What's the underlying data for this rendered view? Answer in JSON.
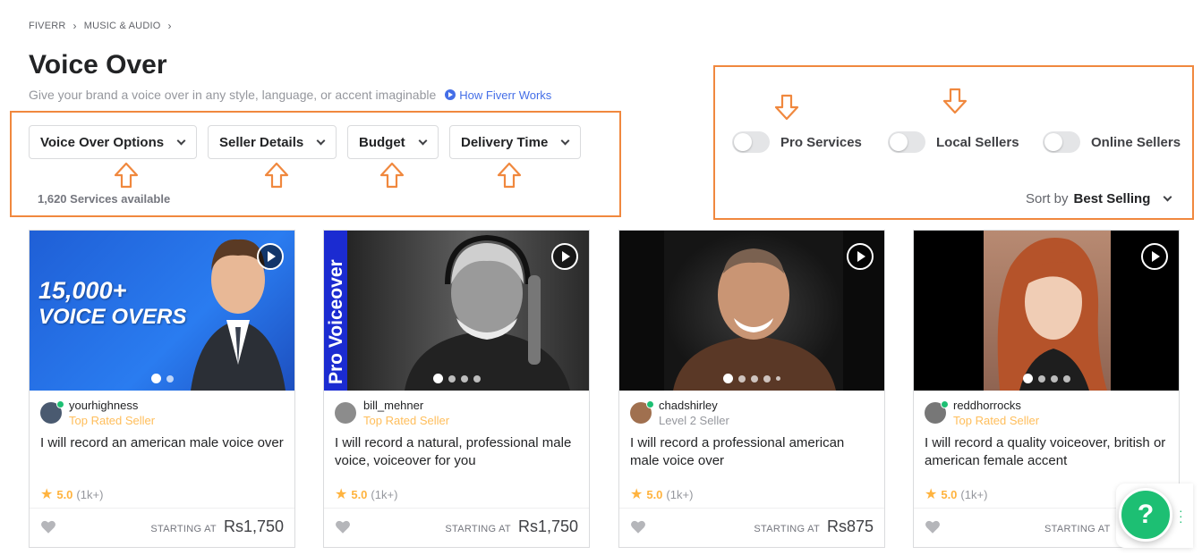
{
  "breadcrumb": {
    "items": [
      "FIVERR",
      "MUSIC & AUDIO"
    ],
    "sep": "›"
  },
  "page": {
    "title": "Voice Over",
    "subtitle": "Give your brand a voice over in any style, language, or accent imaginable",
    "how_link": "How Fiverr Works"
  },
  "filters": {
    "voice_over_options": "Voice Over Options",
    "seller_details": "Seller Details",
    "budget": "Budget",
    "delivery_time": "Delivery Time",
    "services_count": "1,620 Services available"
  },
  "toggles": {
    "pro_services": "Pro Services",
    "local_sellers": "Local Sellers",
    "online_sellers": "Online Sellers"
  },
  "sort": {
    "label": "Sort by",
    "value": "Best Selling"
  },
  "gigs": [
    {
      "seller": "yourhighness",
      "level": "Top Rated Seller",
      "title": "I will record an american male voice over",
      "rating": "5.0",
      "reviews": "(1k+)",
      "starting_label": "STARTING AT",
      "price": "Rs1,750",
      "thumb_text_1": "15,000+",
      "thumb_text_2": "VOICE OVERS",
      "online": true
    },
    {
      "seller": "bill_mehner",
      "level": "Top Rated Seller",
      "title": "I will record a natural, professional male voice, voiceover for you",
      "rating": "5.0",
      "reviews": "(1k+)",
      "starting_label": "STARTING AT",
      "price": "Rs1,750",
      "thumb_text_1": "Pro Voiceover",
      "online": false
    },
    {
      "seller": "chadshirley",
      "level": "Level 2 Seller",
      "title": "I will record a professional american male voice over",
      "rating": "5.0",
      "reviews": "(1k+)",
      "starting_label": "STARTING AT",
      "price": "Rs875",
      "online": true
    },
    {
      "seller": "reddhorrocks",
      "level": "Top Rated Seller",
      "title": "I will record a quality voiceover, british or american female accent",
      "rating": "5.0",
      "reviews": "(1k+)",
      "starting_label": "STARTING AT",
      "price": "R",
      "online": true
    }
  ],
  "help": {
    "label": "?"
  },
  "colors": {
    "brand_green": "#1dbf73",
    "annotation_orange": "#f0883e",
    "star_gold": "#ffb33e",
    "link_blue": "#446ee7"
  },
  "icons": [
    "chevron-right-icon",
    "play-circle-icon",
    "chevron-down-icon",
    "arrow-up-icon",
    "arrow-down-icon",
    "toggle-icon",
    "play-icon",
    "star-icon",
    "heart-icon",
    "help-icon",
    "kebab-icon"
  ]
}
